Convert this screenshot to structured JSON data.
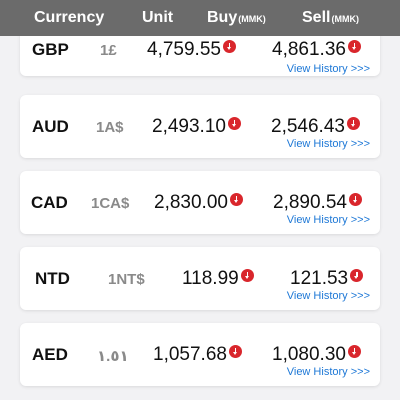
{
  "header": {
    "currency": "Currency",
    "unit": "Unit",
    "buy": "Buy",
    "buy_unit": "(MMK)",
    "sell": "Sell",
    "sell_unit": "(MMK)"
  },
  "rows": [
    {
      "code": "GBP",
      "unit": "1£",
      "buy": "4,759.55",
      "sell": "4,861.36",
      "history": "View History >>>"
    },
    {
      "code": "AUD",
      "unit": "1A$",
      "buy": "2,493.10",
      "sell": "2,546.43",
      "history": "View History >>>"
    },
    {
      "code": "CAD",
      "unit": "1CA$",
      "buy": "2,830.00",
      "sell": "2,890.54",
      "history": "View History >>>"
    },
    {
      "code": "NTD",
      "unit": "1NT$",
      "buy": "118.99",
      "sell": "121.53",
      "history": "View History >>>"
    },
    {
      "code": "AED",
      "unit": "١.٥١",
      "buy": "1,057.68",
      "sell": "1,080.30",
      "history": "View History >>>"
    }
  ],
  "colors": {
    "header_bg": "#6b6b6b",
    "down_arrow": "#d9262c",
    "link": "#1e78d6"
  },
  "icons": {
    "rate_trend": "down-arrow-icon"
  }
}
